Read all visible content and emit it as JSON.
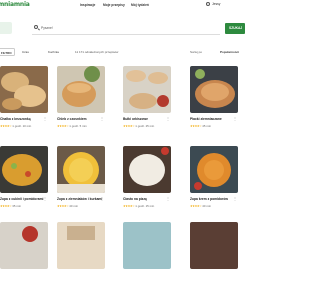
{
  "header": {
    "logo": "mniamnia",
    "nav": [
      "Inspiracje",
      "Moje przepisy",
      "Mój tydzień"
    ],
    "user": "Jessy"
  },
  "search": {
    "placeholder": "Pyszne!",
    "button_label": "SZUKAJ"
  },
  "filters": {
    "reset_label": "FILTRO",
    "chips": [
      "Czas",
      "Kuchnia"
    ],
    "count_text": "11 171 odnalezionych przepisów",
    "sort_label": "Sortuj po",
    "sort_value": "Popularności"
  },
  "recipes": [
    {
      "title": "Chałka z kruszonką",
      "rating": "★★★★☆",
      "time": "1 godz. 10 min"
    },
    {
      "title": "Chleb z czosnkiem",
      "rating": "★★★★☆",
      "time": "1 godz. 5 min"
    },
    {
      "title": "Bułki orkiszowe",
      "rating": "★★★★☆",
      "time": "1 godz. 25 min"
    },
    {
      "title": "Placki ziemniaczane",
      "rating": "★★★★☆",
      "time": "45 min"
    },
    {
      "title": "",
      "rating": "",
      "time": ""
    },
    {
      "title": "Zupa z cukinii i pomidorami",
      "rating": "★★★★☆",
      "time": "35 min"
    },
    {
      "title": "Zupa z ziemniaków i kurkami",
      "rating": "★★★★☆",
      "time": "40 min"
    },
    {
      "title": "Zupa z brzoskwiń ryglików",
      "rating": "★★★★☆",
      "time": "1 godz."
    },
    {
      "title": "Ciasto na pizzę",
      "rating": "★★★★☆",
      "time": "1 godz. 15 min"
    },
    {
      "title": "Zupa krem z pomidorów",
      "rating": "★★★★☆",
      "time": "40 min"
    }
  ],
  "colors": {
    "brand": "#2d8a3e",
    "star": "#f2a900"
  }
}
